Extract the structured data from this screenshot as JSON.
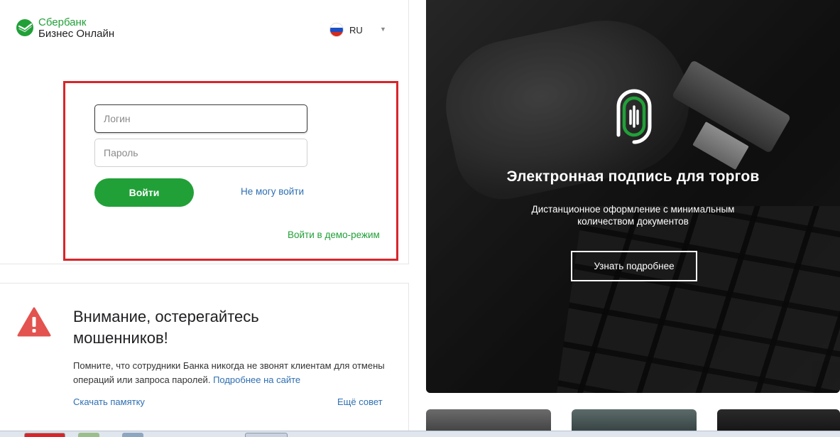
{
  "header": {
    "logo_line1": "Сбербанк",
    "logo_line2": "Бизнес Онлайн",
    "language": "RU"
  },
  "login_form": {
    "login_placeholder": "Логин",
    "password_placeholder": "Пароль",
    "submit_label": "Войти",
    "cant_login_link": "Не могу войти",
    "demo_link": "Войти в демо-режим"
  },
  "warning": {
    "title": "Внимание, остерегайтесь мошенников!",
    "body": "Помните, что сотрудники Банка никогда не звонят клиентам для отмены операций или запроса паролей.",
    "more_link": "Подробнее на сайте",
    "memo_link": "Скачать памятку",
    "tip_link": "Ещё совет"
  },
  "promo": {
    "title": "Электронная подпись для торгов",
    "subtitle_line1": "Дистанционное оформление с минимальным",
    "subtitle_line2": "количеством документов",
    "button_label": "Узнать подробнее"
  },
  "colors": {
    "brand_green": "#21a038",
    "link_blue": "#2f6fb2",
    "highlight_red": "#d9252a",
    "warning_red": "#e3534f"
  },
  "icons": {
    "logo": "sberbank-logo-icon",
    "flag": "russian-flag-icon",
    "chevron": "chevron-down-icon",
    "warning": "warning-triangle-icon",
    "fingerprint": "fingerprint-icon"
  }
}
